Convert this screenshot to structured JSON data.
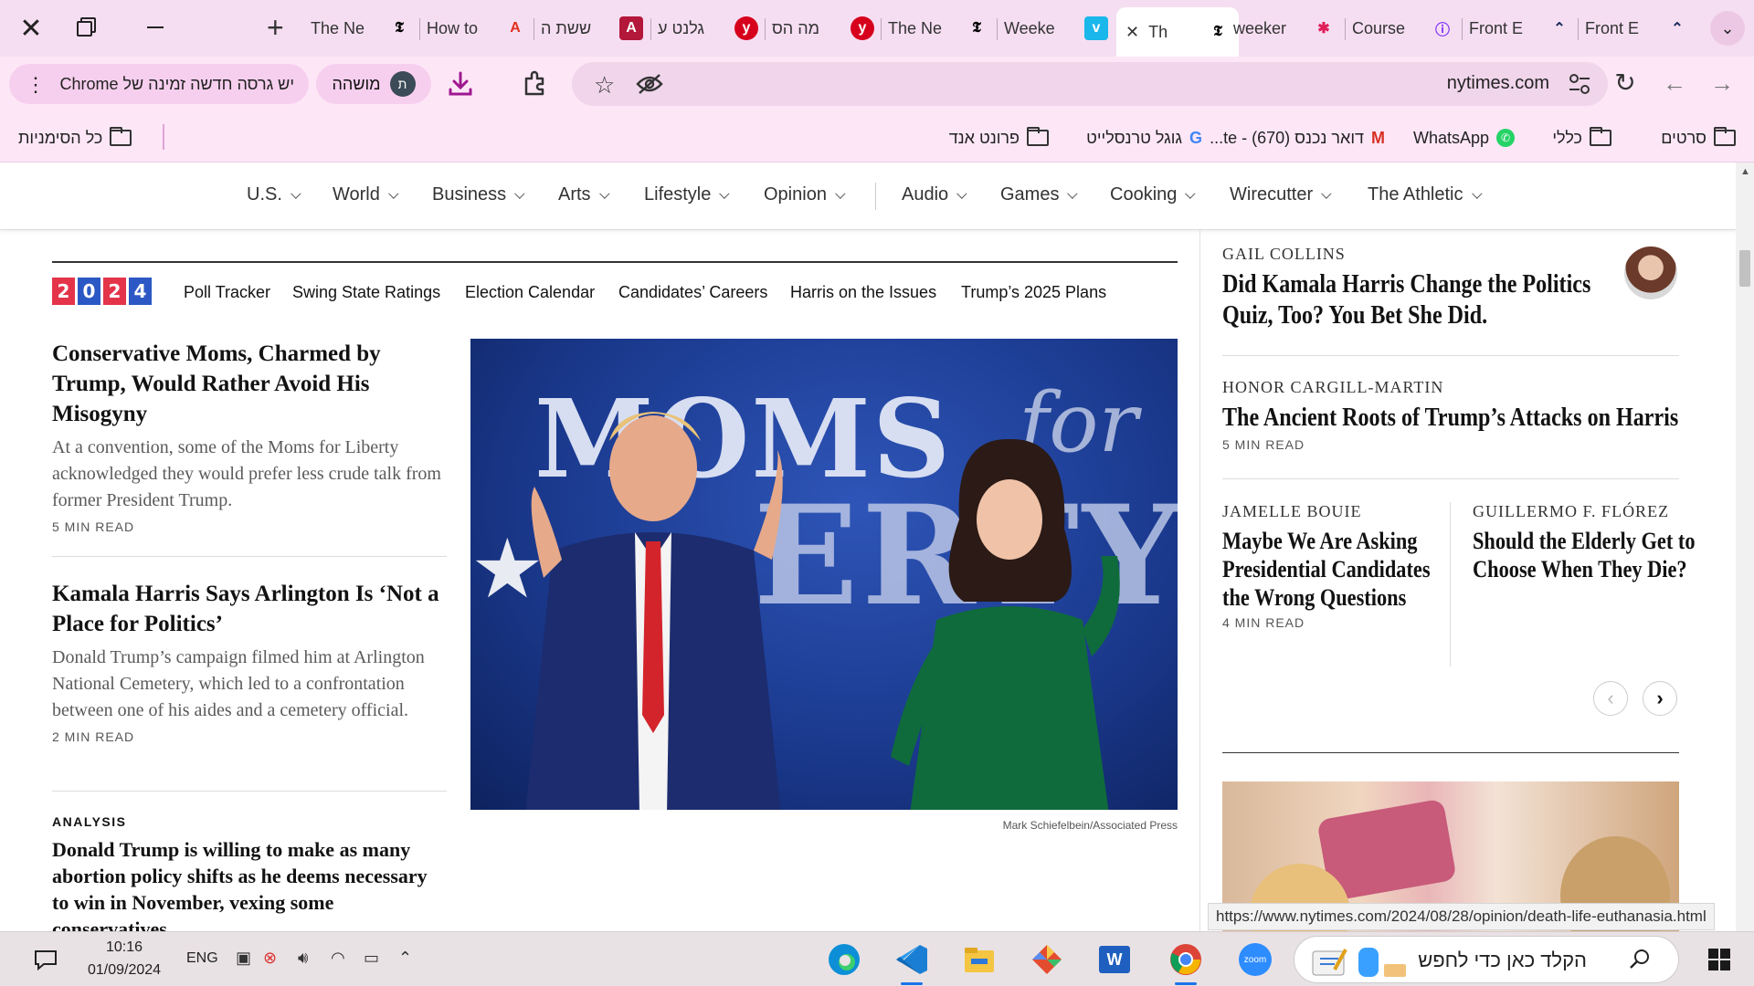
{
  "browser": {
    "tabs": [
      {
        "title": "The Ne",
        "favicon": "nyt-icon",
        "fav_text": "𝕿",
        "color": "#000000"
      },
      {
        "title": "How to",
        "favicon": "adobe-icon",
        "fav_text": "A",
        "color": "#e0301e"
      },
      {
        "title": "ששת ה",
        "favicon": "acrobat-icon",
        "fav_text": "A",
        "color": "#b3173a"
      },
      {
        "title": "גלנט ע",
        "favicon": "ynet-icon",
        "fav_text": "y",
        "color": "#d6001c"
      },
      {
        "title": "מה הס",
        "favicon": "ynet-icon",
        "fav_text": "y",
        "color": "#d6001c"
      },
      {
        "title": "The Ne",
        "favicon": "nyt-icon",
        "fav_text": "𝕿",
        "color": "#000000"
      },
      {
        "title": "Weeke",
        "favicon": "vimeo-icon",
        "fav_text": "v",
        "color": "#1ab7ea"
      },
      {
        "title": "Th",
        "favicon": "nyt-icon",
        "fav_text": "𝕿",
        "color": "#000000",
        "active": true
      },
      {
        "title": "weeker",
        "favicon": "slack-icon",
        "fav_text": "✱",
        "color": "#e01e5a"
      },
      {
        "title": "Course",
        "favicon": "course-icon",
        "fav_text": "ⓘ",
        "color": "#7b2ff7"
      },
      {
        "title": "Front E",
        "favicon": "frontend-icon",
        "fav_text": "⌃",
        "color": "#1a2b5c"
      },
      {
        "title": "Front E",
        "favicon": "frontend-icon",
        "fav_text": "⌃",
        "color": "#1a2b5c"
      }
    ],
    "update_pill": "יש גרסה חדשה זמינה של Chrome",
    "profile_label": "מושהה",
    "profile_initial": "ת",
    "url": "nytimes.com",
    "bookmarks": {
      "all": "כל הסימניות",
      "items": [
        {
          "label": "סרטים",
          "icon": "folder-icon"
        },
        {
          "label": "כללי",
          "icon": "folder-icon"
        },
        {
          "label": "WhatsApp",
          "icon": "whatsapp-icon"
        },
        {
          "label": "דואר נכנס (670) - te...",
          "icon": "gmail-icon"
        },
        {
          "label": "גוגל טרנסלייט",
          "icon": "google-icon"
        },
        {
          "label": "פרונט אנד",
          "icon": "folder-icon"
        }
      ]
    }
  },
  "nyt": {
    "nav": [
      "U.S.",
      "World",
      "Business",
      "Arts",
      "Lifestyle",
      "Opinion",
      "Audio",
      "Games",
      "Cooking",
      "Wirecutter",
      "The Athletic"
    ],
    "election_badge": [
      "2",
      "0",
      "2",
      "4"
    ],
    "election_badge_colors": [
      "#e4344a",
      "#2b58c4",
      "#e4344a",
      "#2b58c4"
    ],
    "election_links": [
      "Poll Tracker",
      "Swing State Ratings",
      "Election Calendar",
      "Candidates’ Careers",
      "Harris on the Issues",
      "Trump’s 2025 Plans"
    ],
    "stories": [
      {
        "headline": "Conservative Moms, Charmed by Trump, Would Rather Avoid His Misogyny",
        "summary": "At a convention, some of the Moms for Liberty acknowledged they would prefer less crude talk from former President Trump.",
        "read": "5 MIN READ"
      },
      {
        "headline": "Kamala Harris Says Arlington Is ‘Not a Place for Politics’",
        "summary": "Donald Trump’s campaign filmed him at Arlington National Cemetery, which led to a confrontation between one of his aides and a cemetery official.",
        "read": "2 MIN READ"
      },
      {
        "kicker": "ANALYSIS",
        "headline": "Donald Trump is willing to make as many abortion policy shifts as he deems necessary to win in November, vexing some conservatives."
      }
    ],
    "hero": {
      "sign_word1": "MOMS",
      "sign_word2": "ERTY",
      "sign_script": "for",
      "credit": "Mark Schiefelbein/Associated Press"
    },
    "opinion": [
      {
        "author": "GAIL COLLINS",
        "headline_lines": [
          "Did Kamala Harris Change the Politics",
          "Quiz, Too? You Bet She Did."
        ]
      },
      {
        "author": "HONOR CARGILL-MARTIN",
        "headline_lines": [
          "The Ancient Roots of Trump’s Attacks on Harris"
        ],
        "read": "5 MIN READ"
      },
      {
        "author": "JAMELLE BOUIE",
        "headline_lines": [
          "Maybe We Are Asking",
          "Presidential Candidates",
          "the Wrong Questions"
        ],
        "read": "4 MIN READ"
      },
      {
        "author": "GUILLERMO F. FLÓREZ",
        "headline_lines": [
          "Should the Elderly Get to",
          "Choose When They Die?"
        ]
      }
    ],
    "carousel": {
      "prev": "‹",
      "next": "›"
    }
  },
  "status_url": "https://www.nytimes.com/2024/08/28/opinion/death-life-euthanasia.html",
  "taskbar": {
    "time": "10:16",
    "date": "01/09/2024",
    "lang": "ENG",
    "search_placeholder": "הקלד כאן כדי לחפש",
    "apps": [
      "edge-icon",
      "vscode-icon",
      "file-explorer-icon",
      "git-icon",
      "word-icon",
      "chrome-icon",
      "zoom-icon"
    ],
    "zoom_label": "zoom",
    "word_label": "W"
  }
}
